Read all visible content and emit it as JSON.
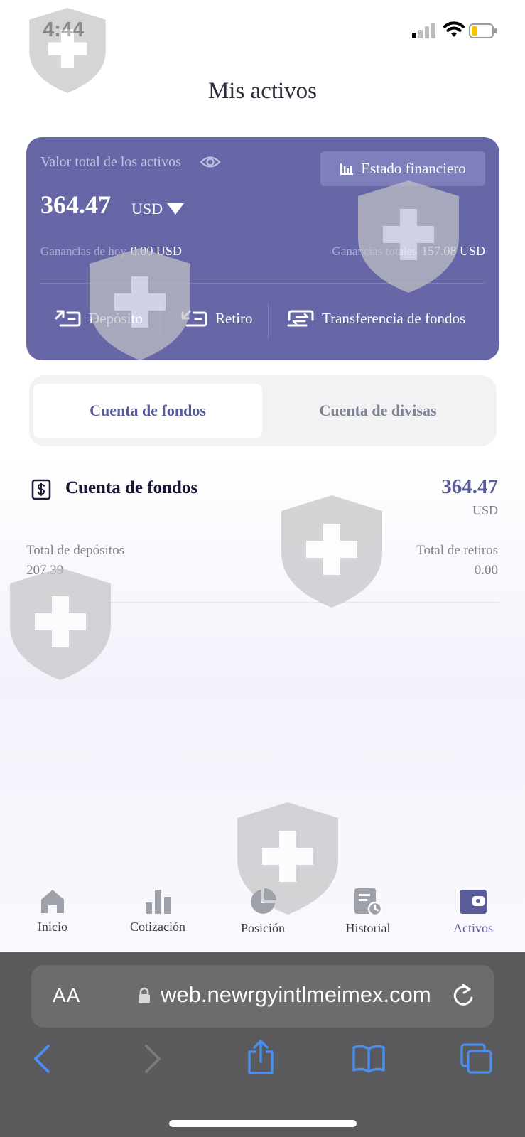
{
  "status_bar": {
    "time": "4:44"
  },
  "page": {
    "title": "Mis activos"
  },
  "summary": {
    "total_label": "Valor total de los activos",
    "statement_button": "Estado financiero",
    "total_value": "364.47",
    "currency": "USD",
    "today_gain_label": "Ganancias de hoy",
    "today_gain_value": "0.00 USD",
    "total_gain_label": "Ganancias totales",
    "total_gain_value": "157.08 USD",
    "actions": {
      "deposit": "Depósito",
      "withdraw": "Retiro",
      "transfer": "Transferencia de fondos"
    }
  },
  "tabs": {
    "funds": "Cuenta de fondos",
    "currency": "Cuenta de divisas",
    "active": "funds"
  },
  "account": {
    "title": "Cuenta de fondos",
    "value": "364.47",
    "currency": "USD",
    "deposits_label": "Total de depósitos",
    "deposits_value": "207.39",
    "withdrawals_label": "Total de retiros",
    "withdrawals_value": "0.00"
  },
  "bottom_nav": {
    "home": "Inicio",
    "quotes": "Cotización",
    "position": "Posición",
    "history": "Historial",
    "assets": "Activos",
    "active": "assets"
  },
  "browser": {
    "text_size_label": "AA",
    "url": "web.newrgyintlmeimex.com"
  },
  "colors": {
    "accent": "#5a5c9a",
    "card": "#6767a8",
    "safari_link": "#4a8ef0"
  }
}
